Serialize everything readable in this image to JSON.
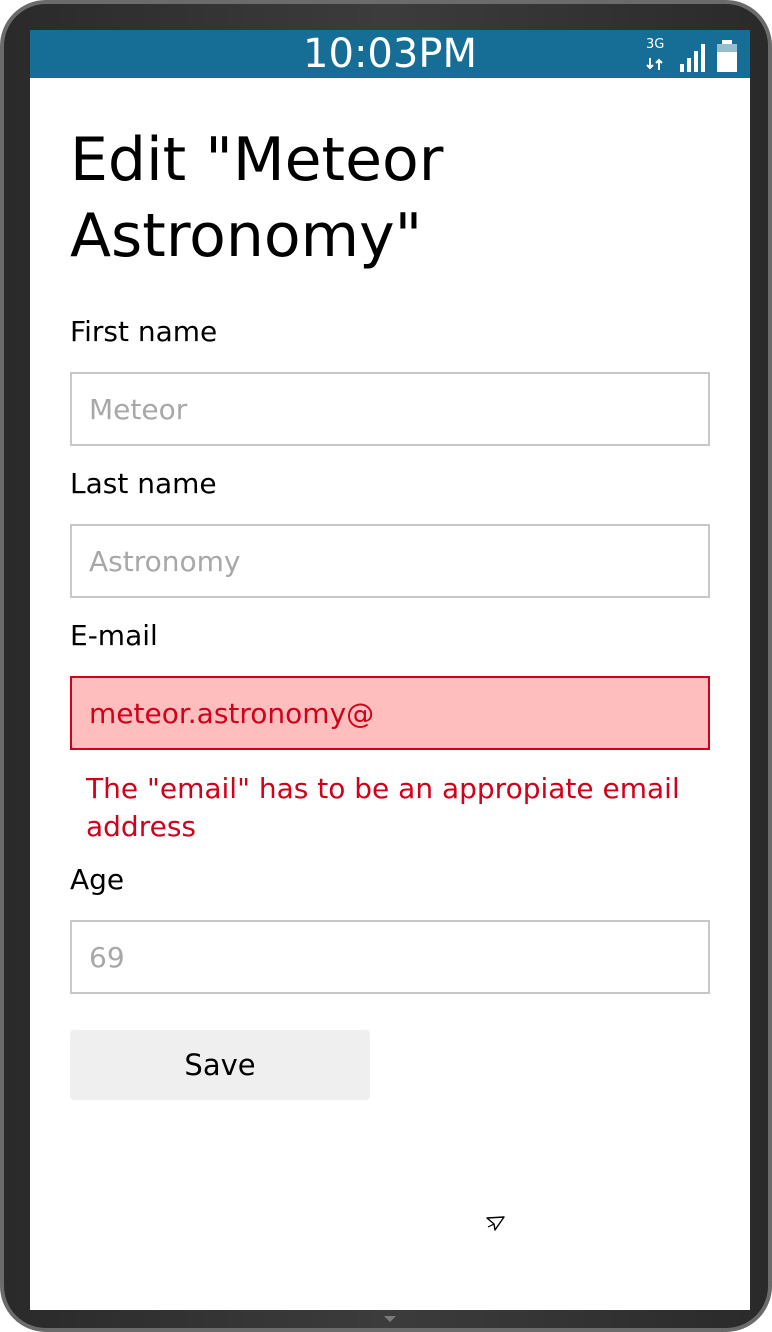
{
  "statusbar": {
    "time": "10:03PM",
    "network_type": "3G",
    "icons": [
      "network-3g-icon",
      "signal-icon",
      "battery-icon"
    ],
    "color": "#166e96"
  },
  "page": {
    "title": "Edit \"Meteor Astronomy\""
  },
  "form": {
    "first_name": {
      "label": "First name",
      "placeholder": "Meteor"
    },
    "last_name": {
      "label": "Last name",
      "placeholder": "Astronomy"
    },
    "email": {
      "label": "E-mail",
      "value": "meteor.astronomy@",
      "error": "The \"email\" has to be an appropiate email address",
      "error_color": "#d0021b",
      "error_bg": "#ffbebe"
    },
    "age": {
      "label": "Age",
      "placeholder": "69"
    },
    "save_label": "Save"
  }
}
